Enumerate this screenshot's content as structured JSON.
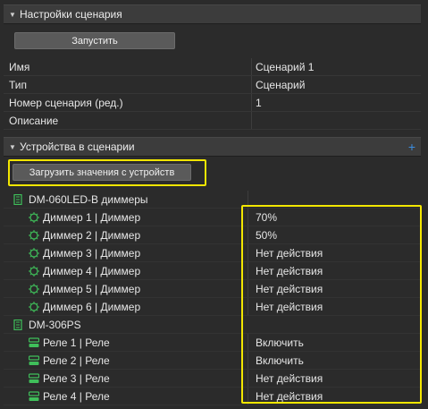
{
  "scenario_settings": {
    "header": "Настройки сценария",
    "run_button": "Запустить",
    "properties": [
      {
        "name": "Имя",
        "value": "Сценарий 1"
      },
      {
        "name": "Тип",
        "value": "Сценарий"
      },
      {
        "name": "Номер сценария (ред.)",
        "value": "1"
      },
      {
        "name": "Описание",
        "value": ""
      }
    ]
  },
  "devices_section": {
    "header": "Устройства в сценарии",
    "add_icon": "+",
    "load_button": "Загрузить значения с устройств",
    "groups": [
      {
        "name": "DM-060LED-B диммеры",
        "icon": "dimmer-module-icon",
        "items": [
          {
            "label": "Диммер 1 | Диммер",
            "value": "70%",
            "icon": "dimmer-icon"
          },
          {
            "label": "Диммер 2 | Диммер",
            "value": "50%",
            "icon": "dimmer-icon"
          },
          {
            "label": "Диммер 3 | Диммер",
            "value": "Нет действия",
            "icon": "dimmer-icon"
          },
          {
            "label": "Диммер 4 | Диммер",
            "value": "Нет действия",
            "icon": "dimmer-icon"
          },
          {
            "label": "Диммер 5 | Диммер",
            "value": "Нет действия",
            "icon": "dimmer-icon"
          },
          {
            "label": "Диммер 6 | Диммер",
            "value": "Нет действия",
            "icon": "dimmer-icon"
          }
        ]
      },
      {
        "name": "DM-306PS",
        "icon": "relay-module-icon",
        "items": [
          {
            "label": "Реле 1 | Реле",
            "value": "Включить",
            "icon": "relay-icon"
          },
          {
            "label": "Реле 2 | Реле",
            "value": "Включить",
            "icon": "relay-icon"
          },
          {
            "label": "Реле 3 | Реле",
            "value": "Нет действия",
            "icon": "relay-icon"
          },
          {
            "label": "Реле 4 | Реле",
            "value": "Нет действия",
            "icon": "relay-icon"
          }
        ]
      }
    ]
  },
  "colors": {
    "accent": "#3c8de0",
    "highlight": "#f2e600",
    "device_icon": "#3fbf5a"
  }
}
